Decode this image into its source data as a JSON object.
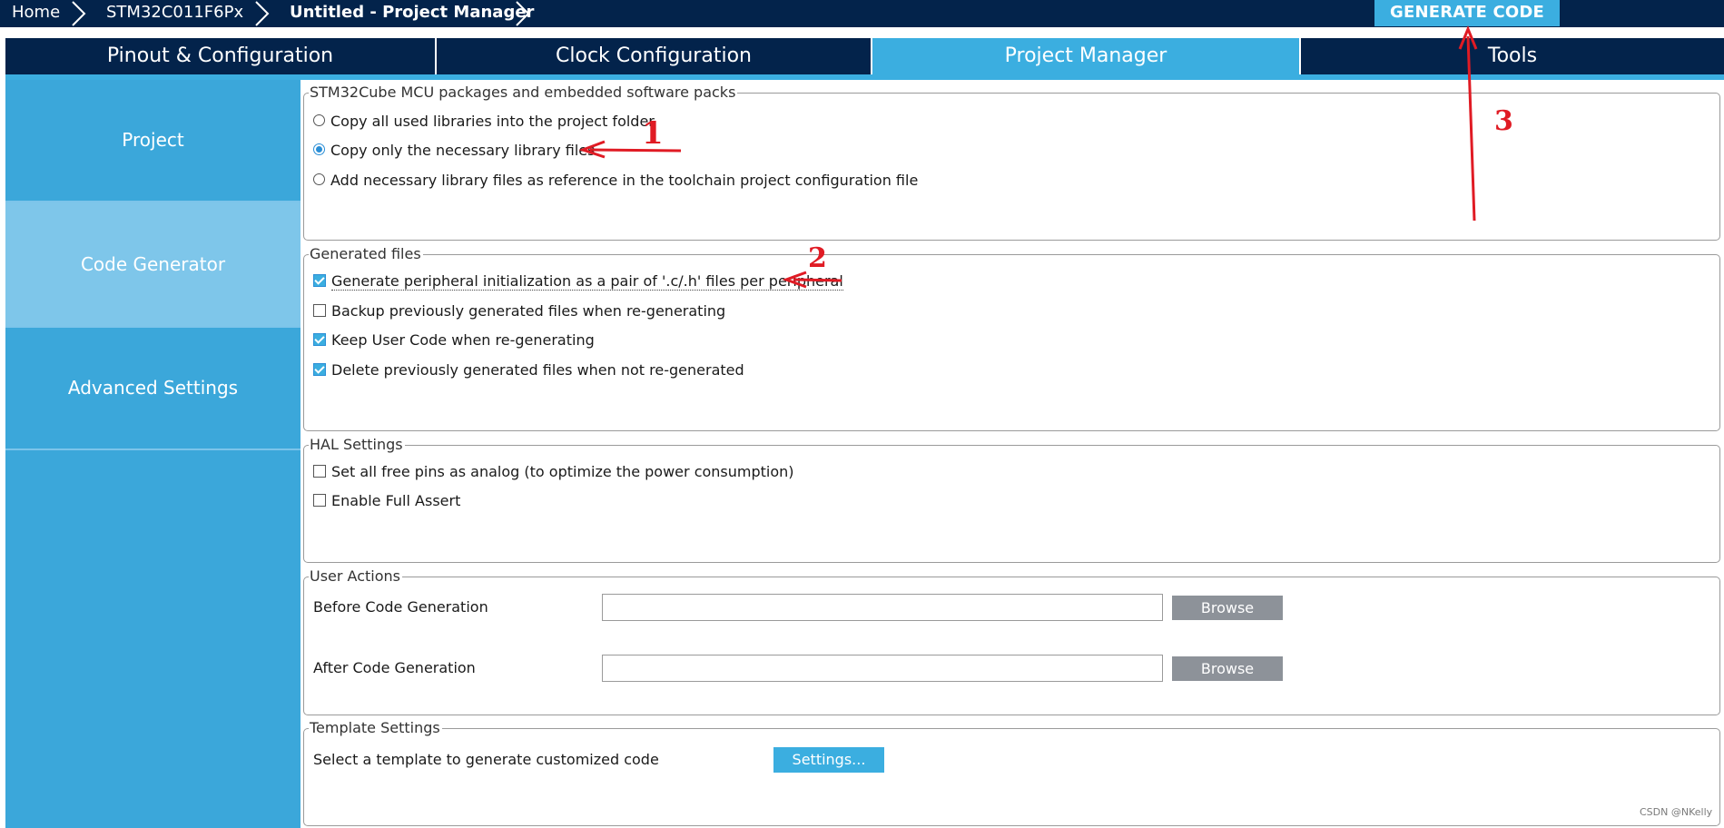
{
  "breadcrumb": {
    "home": "Home",
    "device": "STM32C011F6Px",
    "project": "Untitled - Project Manager"
  },
  "generate_button": "GENERATE CODE",
  "tabs": [
    {
      "label": "Pinout & Configuration"
    },
    {
      "label": "Clock Configuration"
    },
    {
      "label": "Project Manager"
    },
    {
      "label": "Tools"
    }
  ],
  "sidebar": {
    "items": [
      {
        "label": "Project"
      },
      {
        "label": "Code Generator"
      },
      {
        "label": "Advanced Settings"
      }
    ]
  },
  "packages": {
    "legend": "STM32Cube MCU packages and embedded software packs",
    "options": [
      {
        "label": "Copy all used libraries into the project folder",
        "selected": false
      },
      {
        "label": "Copy only the necessary library files",
        "selected": true
      },
      {
        "label": "Add necessary library files as reference in the toolchain project configuration file",
        "selected": false
      }
    ]
  },
  "generated_files": {
    "legend": "Generated files",
    "options": [
      {
        "label": "Generate peripheral initialization as a pair of '.c/.h' files per peripheral",
        "checked": true
      },
      {
        "label": "Backup previously generated files when re-generating",
        "checked": false
      },
      {
        "label": "Keep User Code when re-generating",
        "checked": true
      },
      {
        "label": "Delete previously generated files when not re-generated",
        "checked": true
      }
    ]
  },
  "hal_settings": {
    "legend": "HAL Settings",
    "options": [
      {
        "label": "Set all free pins as analog (to optimize the power consumption)",
        "checked": false
      },
      {
        "label": "Enable Full Assert",
        "checked": false
      }
    ]
  },
  "user_actions": {
    "legend": "User Actions",
    "before_label": "Before Code Generation",
    "before_value": "",
    "after_label": "After Code Generation",
    "after_value": "",
    "browse_label": "Browse"
  },
  "template_settings": {
    "legend": "Template Settings",
    "label": "Select a template to generate customized code",
    "button": "Settings..."
  },
  "annotations": [
    "1",
    "2",
    "3"
  ],
  "annotation_color": "#e01b24",
  "watermark": "CSDN @NKelly",
  "colors": {
    "navy": "#03234b",
    "accent": "#3baee0",
    "sidebar": "#3ba7da",
    "sidebar_active": "#7ec6ea"
  }
}
